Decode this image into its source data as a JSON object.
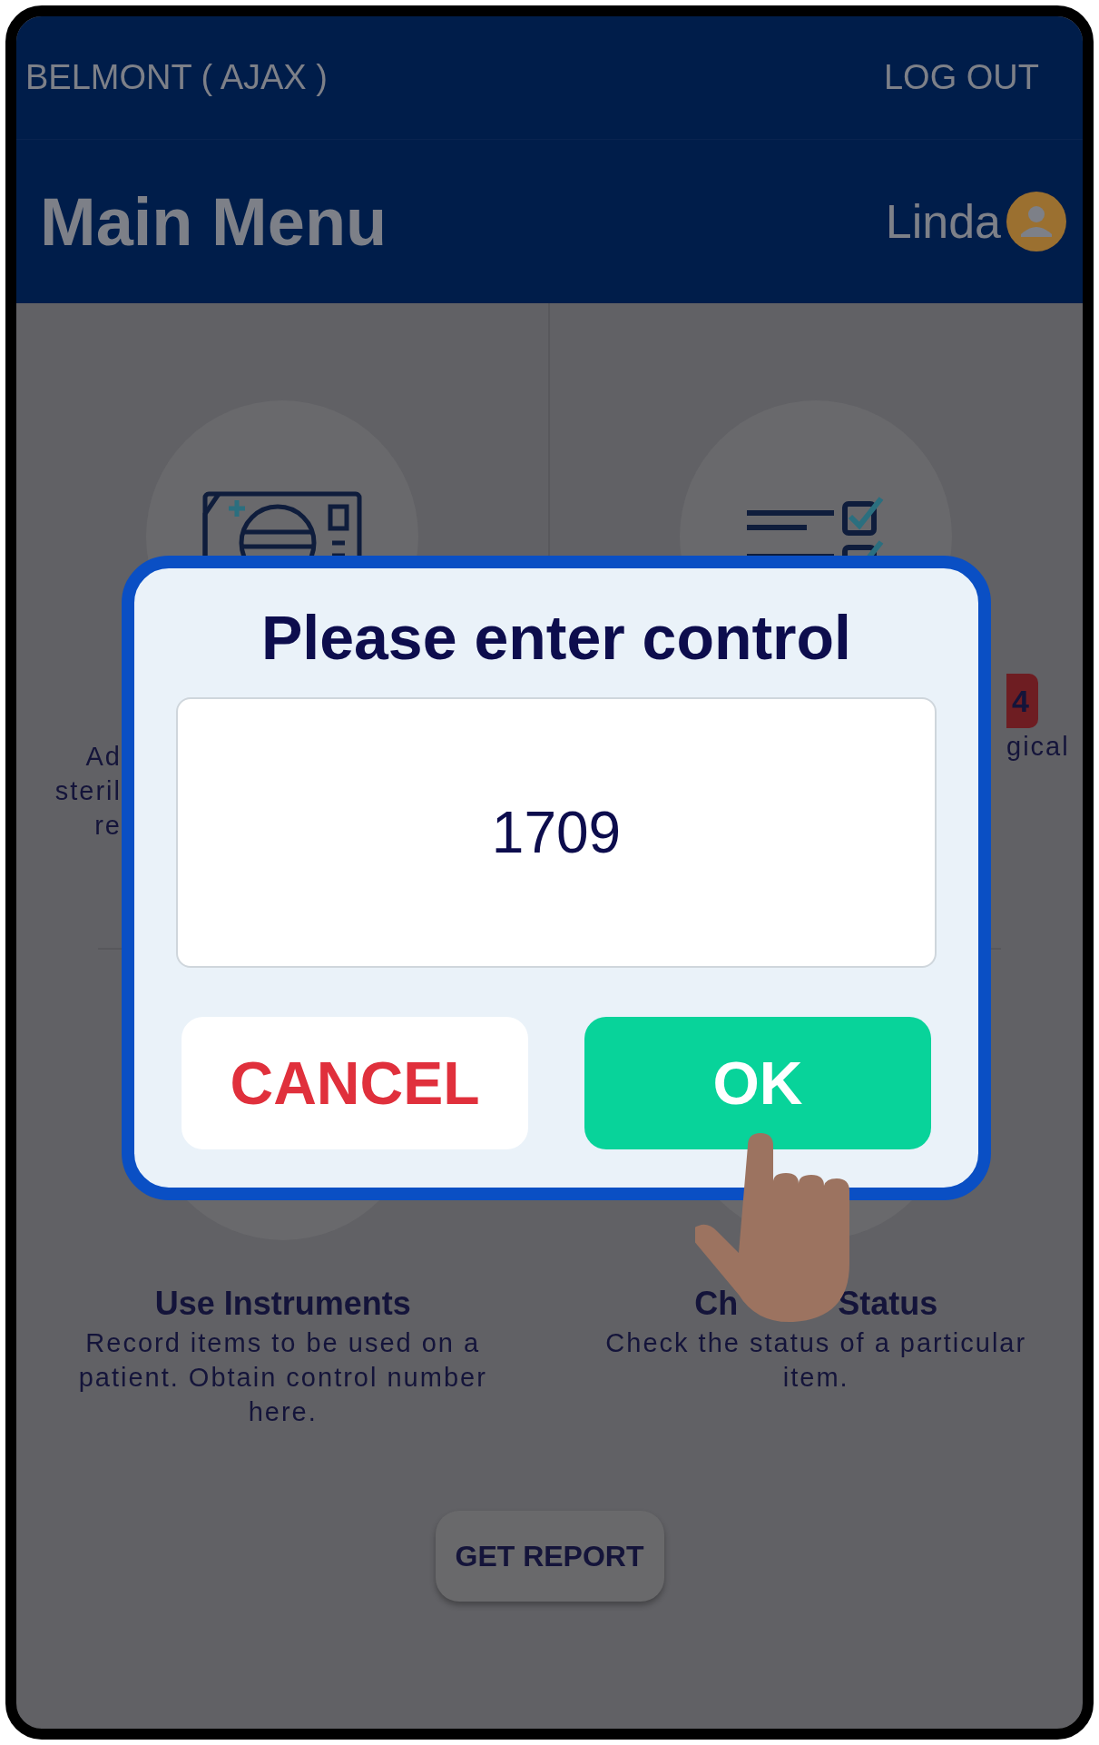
{
  "top_bar": {
    "location": "BELMONT ( AJAX )",
    "logout": "LOG OUT"
  },
  "header": {
    "title": "Main Menu",
    "user": "Linda"
  },
  "cards": [
    {
      "kind": "covered_left",
      "lines": [
        "Ad",
        "steril",
        "re"
      ]
    },
    {
      "kind": "covered_right",
      "badge": "4",
      "lines": [
        "gical"
      ]
    },
    {
      "kind": "full",
      "title_parts": [
        "Use Instruments"
      ],
      "description": "Record items to be used on a patient. Obtain control number here."
    },
    {
      "kind": "full",
      "title_parts": [
        "Ch",
        "Status"
      ],
      "description": "Check the status of a particular item."
    }
  ],
  "dialog": {
    "title": "Please enter control",
    "value": "1709",
    "buttons": [
      {
        "label": "CANCEL",
        "kind": "cancel"
      },
      {
        "label": "OK",
        "kind": "confirm"
      }
    ]
  },
  "report_button": "GET REPORT"
}
